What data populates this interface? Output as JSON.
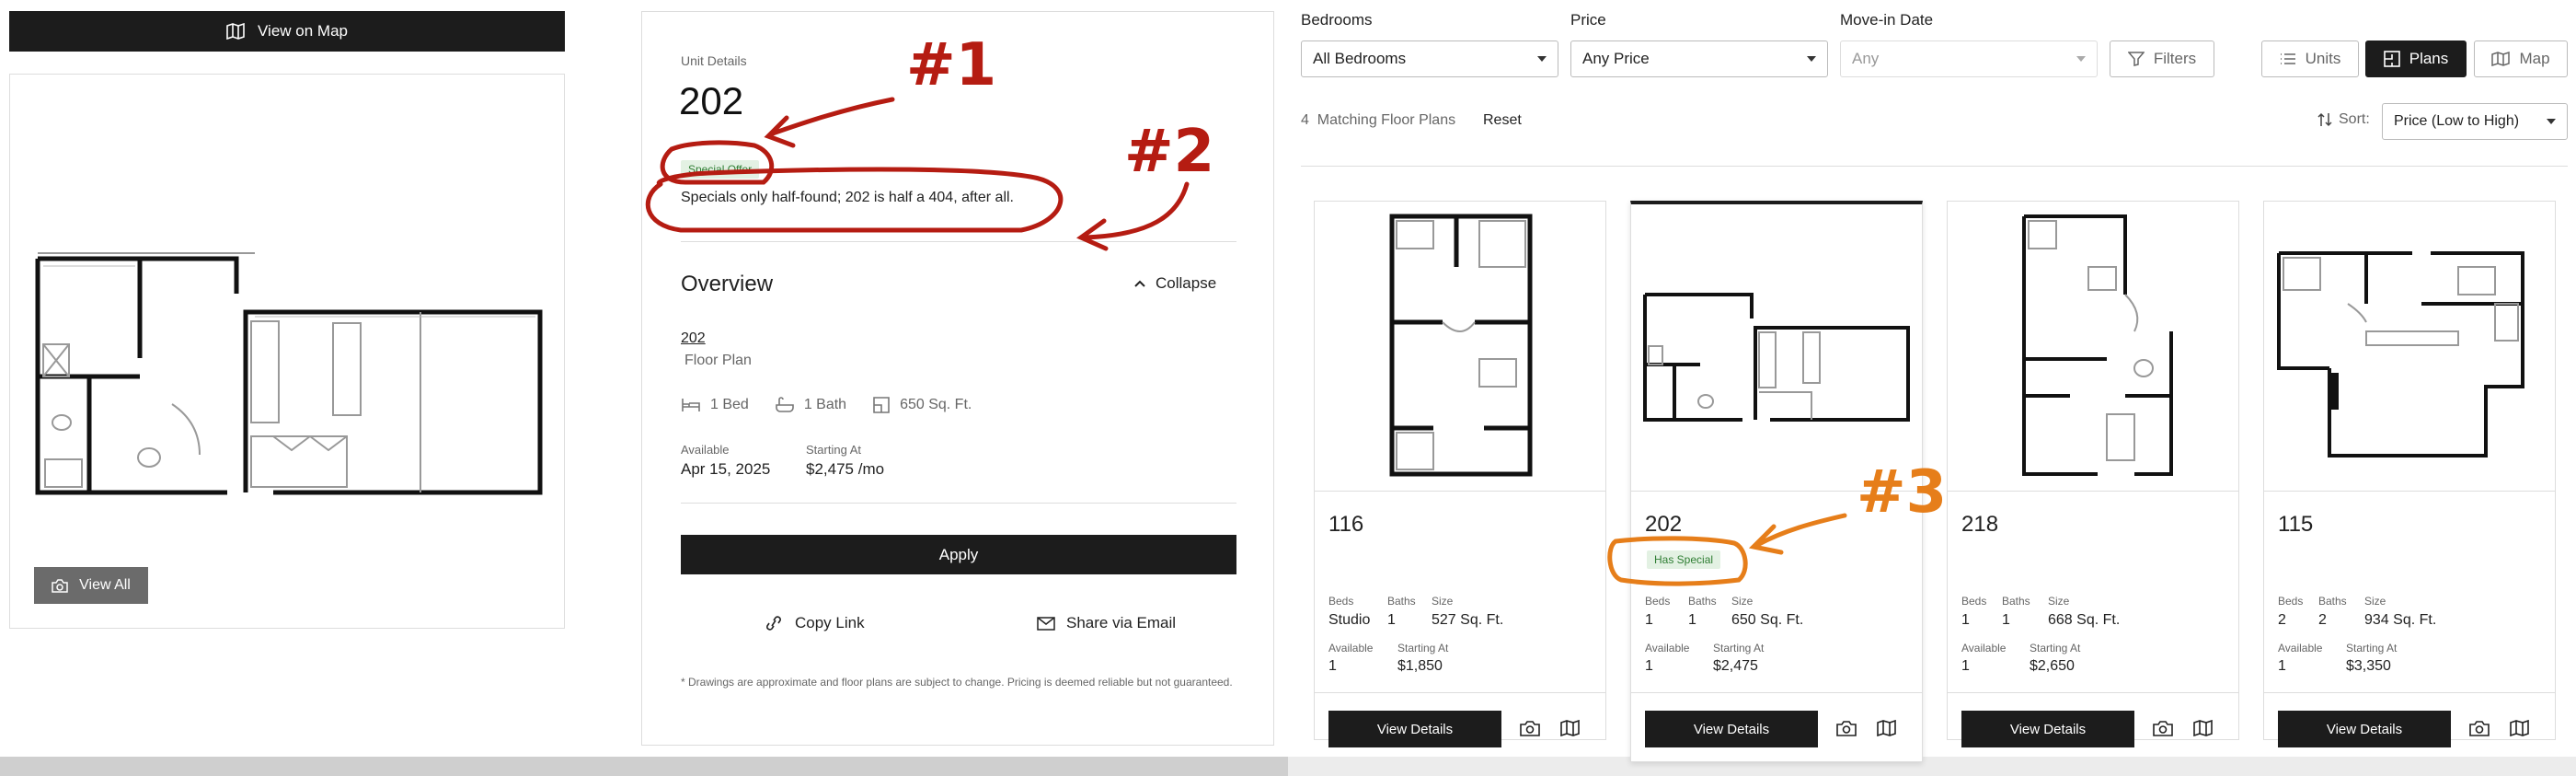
{
  "left": {
    "view_on_map": "View on Map",
    "view_all": "View All"
  },
  "details": {
    "section_label": "Unit Details",
    "unit": "202",
    "special_badge": "Special Offer",
    "special_text": "Specials only half-found; 202 is half a 404, after all.",
    "overview_title": "Overview",
    "collapse": "Collapse",
    "plan_link": "202",
    "plan_type": "Floor Plan",
    "beds": "1 Bed",
    "baths": "1 Bath",
    "size": "650 Sq. Ft.",
    "available_label": "Available",
    "available_value": "Apr 15, 2025",
    "starting_label": "Starting At",
    "starting_value": "$2,475 /mo",
    "apply": "Apply",
    "copy_link": "Copy Link",
    "share_email": "Share via Email",
    "disclaimer": "* Drawings are approximate and floor plans are subject to change. Pricing is deemed reliable but not guaranteed."
  },
  "filters": {
    "bedrooms_label": "Bedrooms",
    "bedrooms_value": "All Bedrooms",
    "price_label": "Price",
    "price_value": "Any Price",
    "movein_label": "Move-in Date",
    "movein_value": "Any",
    "filters_btn": "Filters",
    "units_btn": "Units",
    "plans_btn": "Plans",
    "map_btn": "Map",
    "count": "4",
    "matching": "Matching Floor Plans",
    "reset": "Reset",
    "sort_label": "Sort:",
    "sort_value": "Price (Low to High)"
  },
  "cards": [
    {
      "unit": "116",
      "badge": "",
      "beds_label": "Beds",
      "baths_label": "Baths",
      "size_label": "Size",
      "beds": "Studio",
      "baths": "1",
      "size": "527 Sq. Ft.",
      "available_label": "Available",
      "available": "1",
      "starting_label": "Starting At",
      "starting": "$1,850",
      "view": "View Details"
    },
    {
      "unit": "202",
      "badge": "Has Special",
      "beds_label": "Beds",
      "baths_label": "Baths",
      "size_label": "Size",
      "beds": "1",
      "baths": "1",
      "size": "650 Sq. Ft.",
      "available_label": "Available",
      "available": "1",
      "starting_label": "Starting At",
      "starting": "$2,475",
      "view": "View Details"
    },
    {
      "unit": "218",
      "badge": "",
      "beds_label": "Beds",
      "baths_label": "Baths",
      "size_label": "Size",
      "beds": "1",
      "baths": "1",
      "size": "668 Sq. Ft.",
      "available_label": "Available",
      "available": "1",
      "starting_label": "Starting At",
      "starting": "$2,650",
      "view": "View Details"
    },
    {
      "unit": "115",
      "badge": "",
      "beds_label": "Beds",
      "baths_label": "Baths",
      "size_label": "Size",
      "beds": "2",
      "baths": "2",
      "size": "934 Sq. Ft.",
      "available_label": "Available",
      "available": "1",
      "starting_label": "Starting At",
      "starting": "$3,350",
      "view": "View Details"
    }
  ],
  "annotations": {
    "a1": "#1",
    "a2": "#2",
    "a3": "#3"
  },
  "colors": {
    "annotation_red": "#b51c12",
    "annotation_orange": "#e67e1a",
    "primary_dark": "#1c1c1c",
    "special_green": "#2e7d32"
  }
}
